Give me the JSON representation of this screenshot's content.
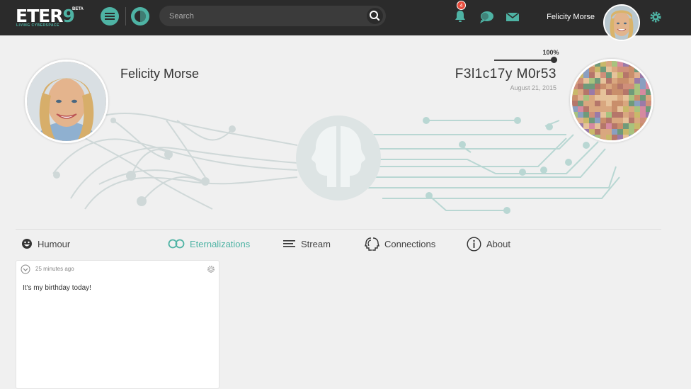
{
  "app": {
    "logo_text": "ETER",
    "logo_o": "9",
    "logo_badge": "BETA",
    "logo_tagline": "LIVING CYBERSPACE",
    "accent_color": "#4eb3a4",
    "topbar_color": "#2b2b2b"
  },
  "search": {
    "placeholder": "Search"
  },
  "topbar": {
    "notification_count": "4",
    "username": "Felicity Morse",
    "icons": [
      "menu-icon",
      "face-profile-icon",
      "search-icon",
      "bell-icon",
      "chat-icon",
      "mail-icon",
      "gear-icon"
    ]
  },
  "profile": {
    "name": "Felicity Morse",
    "eternalized_name": "F3l1c17y M0r53",
    "date": "August 21, 2015",
    "progress_label": "100%",
    "progress_value": 1.0
  },
  "tabs": [
    {
      "label": "Humour",
      "icon": "smiley-icon"
    },
    {
      "label": "Eternalizations",
      "icon": "infinity-icon",
      "active": true
    },
    {
      "label": "Stream",
      "icon": "stream-lines-icon"
    },
    {
      "label": "Connections",
      "icon": "connections-heads-icon"
    },
    {
      "label": "About",
      "icon": "info-icon"
    }
  ],
  "post": {
    "time": "25 minutes ago",
    "text": "It's my birthday today!"
  }
}
